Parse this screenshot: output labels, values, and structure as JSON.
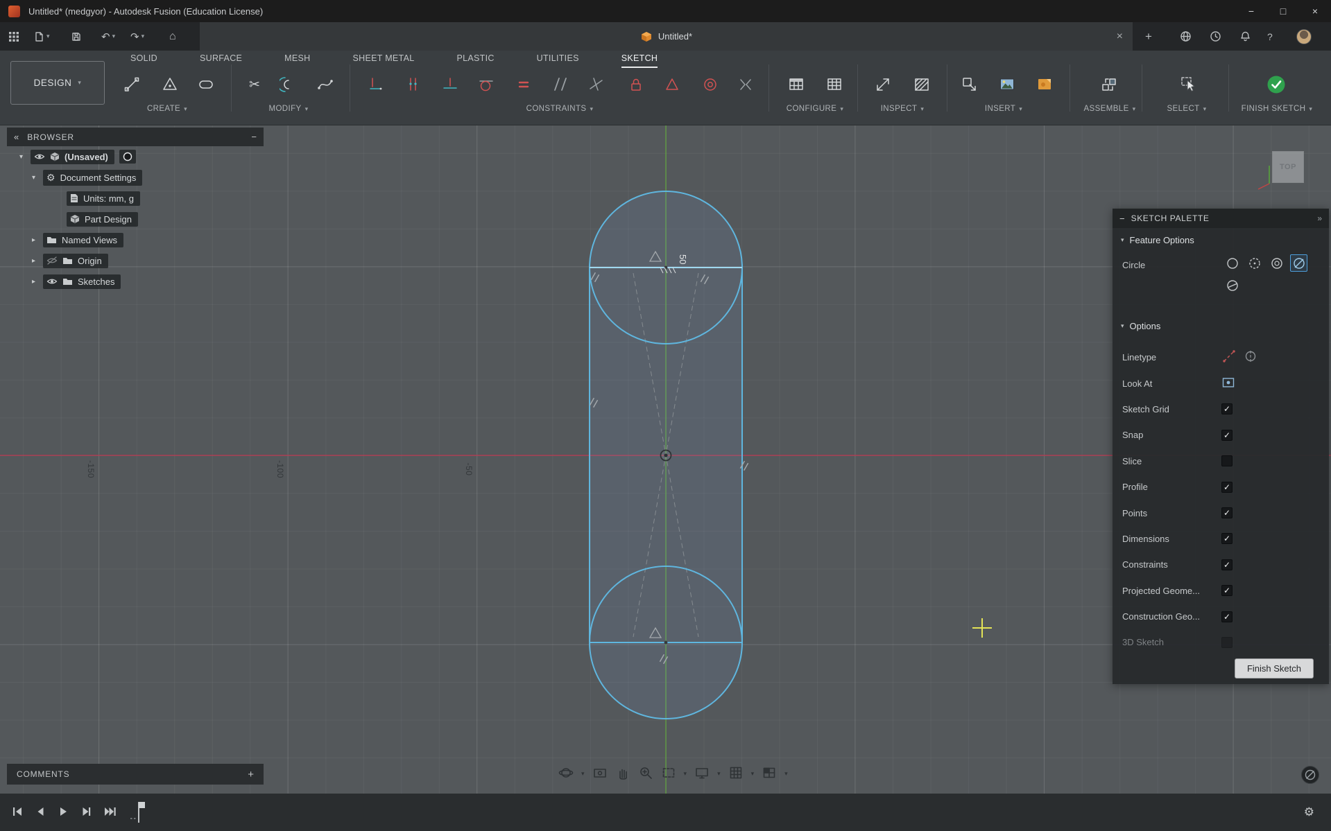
{
  "titlebar": {
    "title": "Untitled* (medgyor) - Autodesk Fusion (Education License)"
  },
  "doc_tab": {
    "label": "Untitled*"
  },
  "workspace_selector": {
    "label": "DESIGN"
  },
  "ribbon_tabs": [
    {
      "label": "SOLID",
      "active": false
    },
    {
      "label": "SURFACE",
      "active": false
    },
    {
      "label": "MESH",
      "active": false
    },
    {
      "label": "SHEET METAL",
      "active": false
    },
    {
      "label": "PLASTIC",
      "active": false
    },
    {
      "label": "UTILITIES",
      "active": false
    },
    {
      "label": "SKETCH",
      "active": true
    }
  ],
  "groups": {
    "create": "CREATE",
    "modify": "MODIFY",
    "constraints": "CONSTRAINTS",
    "configure": "CONFIGURE",
    "inspect": "INSPECT",
    "insert": "INSERT",
    "assemble": "ASSEMBLE",
    "select": "SELECT",
    "finish_sketch": "FINISH SKETCH"
  },
  "browser": {
    "title": "BROWSER",
    "items": [
      {
        "label": "(Unsaved)"
      },
      {
        "label": "Document Settings"
      },
      {
        "label": "Units: mm, g"
      },
      {
        "label": "Part Design"
      },
      {
        "label": "Named Views"
      },
      {
        "label": "Origin"
      },
      {
        "label": "Sketches"
      }
    ]
  },
  "canvas": {
    "dimension_value": "50",
    "axis_labels": [
      "-150",
      "-100",
      "-50"
    ],
    "viewcube_face": "TOP"
  },
  "sketch_palette": {
    "title": "SKETCH PALETTE",
    "sections": {
      "feature_options": "Feature Options",
      "options": "Options"
    },
    "feature_rows": [
      {
        "label": "Circle"
      }
    ],
    "circle_modes": [
      {
        "name": "center-diameter-circle",
        "selected": false
      },
      {
        "name": "2-point-circle",
        "selected": false
      },
      {
        "name": "3-point-circle",
        "selected": false
      },
      {
        "name": "2-tangent-circle",
        "selected": true
      },
      {
        "name": "3-tangent-circle",
        "selected": false
      }
    ],
    "option_rows": [
      {
        "label": "Linetype"
      },
      {
        "label": "Look At"
      },
      {
        "label": "Sketch Grid",
        "checked": true
      },
      {
        "label": "Snap",
        "checked": true
      },
      {
        "label": "Slice",
        "checked": false
      },
      {
        "label": "Profile",
        "checked": true
      },
      {
        "label": "Points",
        "checked": true
      },
      {
        "label": "Dimensions",
        "checked": true
      },
      {
        "label": "Constraints",
        "checked": true
      },
      {
        "label": "Projected Geome...",
        "checked": true
      },
      {
        "label": "Construction Geo...",
        "checked": true
      },
      {
        "label": "3D Sketch",
        "checked": false,
        "disabled": true
      }
    ],
    "finish_button": "Finish Sketch"
  },
  "comments": {
    "label": "COMMENTS"
  },
  "icons": {
    "caret_down": "▾",
    "caret_right": "▸",
    "collapse_left": "«",
    "expand_right": "»",
    "minimize_panel": "−",
    "window_minimize": "−",
    "window_maximize": "□",
    "window_close": "×",
    "close_tab": "×",
    "home": "⌂",
    "undo": "↶",
    "redo": "↷",
    "scissors": "✂",
    "gear": "⚙",
    "plus": "+",
    "help": "?",
    "check": "✓"
  },
  "colors": {
    "accent_blue": "#4d9fdd",
    "sketch_line": "#5fb6df",
    "axis_green": "#5f9e3f",
    "axis_red": "#ad3a4f",
    "finish_green": "#2fa14d",
    "selection_yellow": "#e3e356"
  }
}
